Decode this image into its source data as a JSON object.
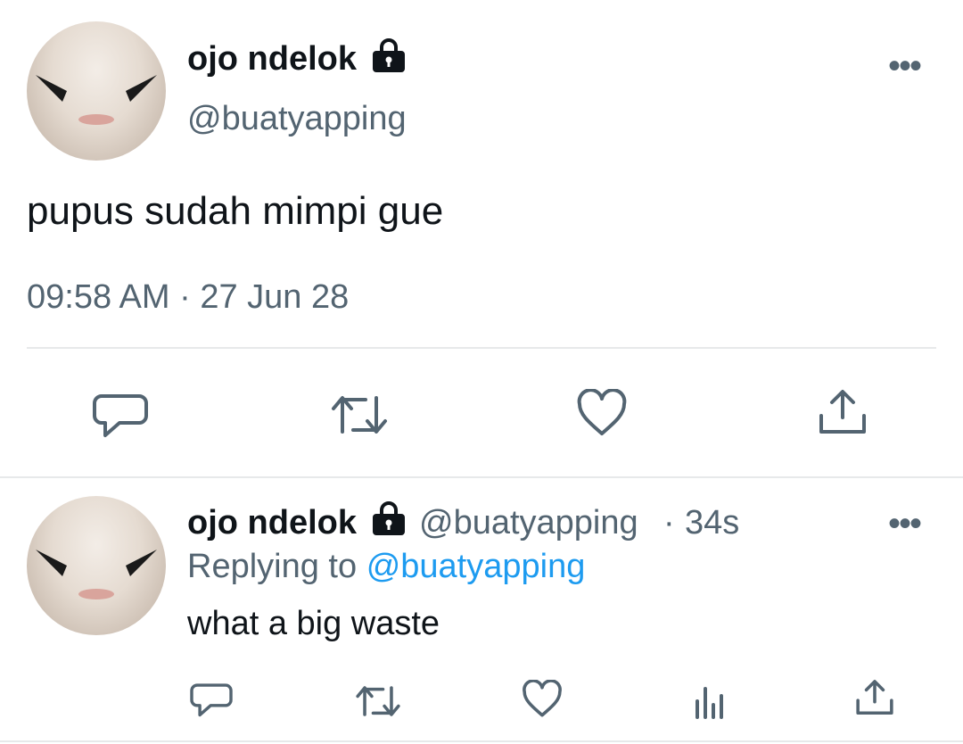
{
  "colors": {
    "text": "#0f1419",
    "secondary": "#536471",
    "accent": "#1d9bf0",
    "divider": "#e7e9ea"
  },
  "main_tweet": {
    "display_name": "ojo ndelok",
    "handle": "@buatyapping",
    "text": "pupus sudah mimpi gue",
    "timestamp": "09:58 AM · 27 Jun 28",
    "more_label": "•••",
    "actions": [
      "reply-icon",
      "retweet-icon",
      "like-icon",
      "share-icon"
    ]
  },
  "reply_tweet": {
    "display_name": "ojo ndelok",
    "handle": "@buatyapping",
    "separator": "·",
    "age": "34s",
    "replying_prefix": "Replying to",
    "replying_to": "@buatyapping",
    "text": "what a big waste",
    "more_label": "•••",
    "actions": [
      "reply-icon",
      "retweet-icon",
      "like-icon",
      "analytics-icon",
      "share-icon"
    ]
  }
}
